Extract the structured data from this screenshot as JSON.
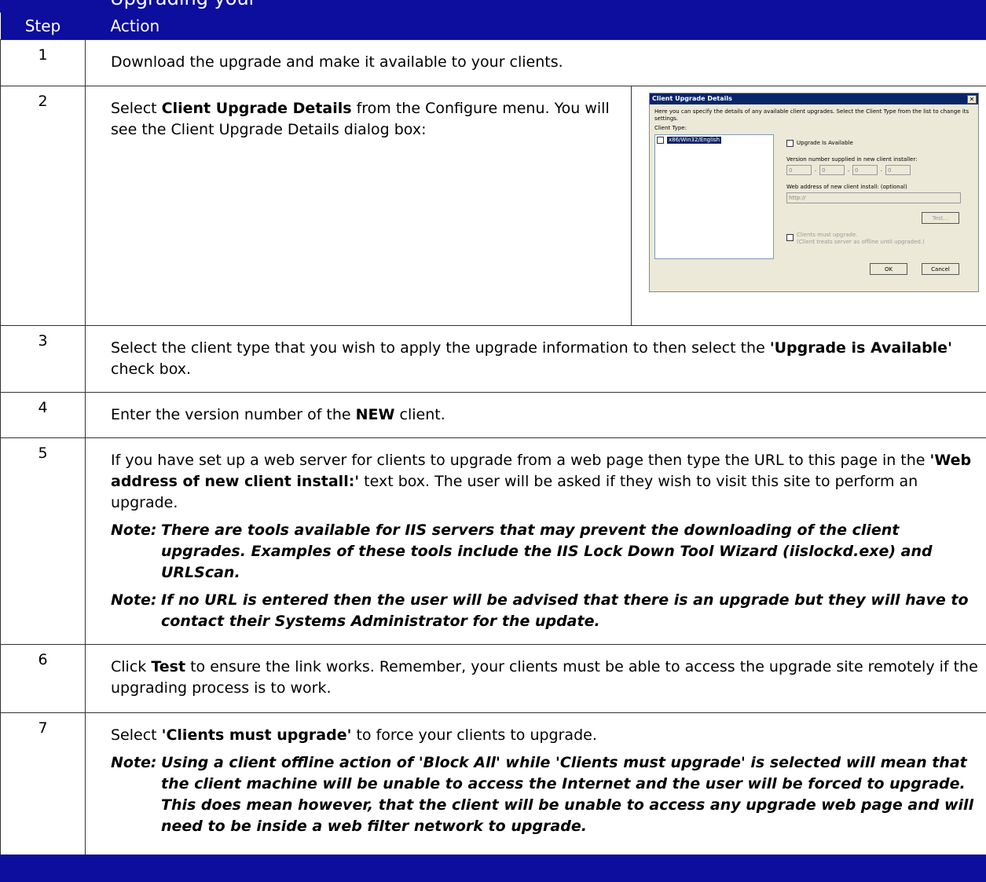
{
  "header": {
    "title_fragment": "Upgrading your",
    "step_label": "Step",
    "action_label": "Action"
  },
  "steps": [
    {
      "num": "1",
      "text": "Download the upgrade and make it available to your clients."
    },
    {
      "num": "2",
      "pre": "Select ",
      "bold": "Client Upgrade Details",
      "post": " from the Configure menu. You will see the Client Upgrade Details dialog box:"
    },
    {
      "num": "3",
      "pre": "Select the client type that you wish to apply the upgrade information to then select the ",
      "bold": "'Upgrade is Available'",
      "post": " check box."
    },
    {
      "num": "4",
      "pre": "Enter the version number of the ",
      "bold": "NEW",
      "post": " client."
    },
    {
      "num": "5",
      "pre": "If you have set up a web server for clients to upgrade from a web page then type the URL to this page in the ",
      "bold": "'Web address of new client install:'",
      "post": " text box. The user will be asked if they wish to visit this site to perform an upgrade.",
      "notes": [
        {
          "label": "Note:",
          "text": "There are tools available for IIS servers that may prevent the downloading of the client upgrades. Examples of these tools include the IIS Lock Down Tool Wizard (iislockd.exe) and URLScan."
        },
        {
          "label": "Note:",
          "text": "If no URL is entered then the user will be advised that there is an upgrade but they will have to contact their Systems Administrator for the update."
        }
      ]
    },
    {
      "num": "6",
      "pre": "Click ",
      "bold": "Test",
      "post": " to ensure the link works. Remember, your clients must be able to access the upgrade site remotely if the upgrading process is to work."
    },
    {
      "num": "7",
      "pre": "Select ",
      "bold": "'Clients must upgrade'",
      "post": " to force your clients to upgrade.",
      "notes": [
        {
          "label": "Note:",
          "text": "Using a client offline action of 'Block All' while 'Clients must upgrade' is selected will mean that the client machine will be unable to access the Internet and the user will be forced to upgrade. This does mean however, that the client will be unable to access any upgrade web page and will need to be inside a web filter network to upgrade."
        }
      ]
    }
  ],
  "dialog": {
    "title": "Client Upgrade Details",
    "close_glyph": "✕",
    "intro": "Here you can specify the details of any available client upgrades.  Select the Client Type from the list to change its settings.",
    "client_type_label": "Client Type:",
    "client_item": "x86/Win32/English",
    "upgrade_available_label": "Upgrade Is Available",
    "version_label": "Version number supplied in new client installer:",
    "version_values": [
      "0",
      "0",
      "0",
      "0"
    ],
    "version_sep": ".",
    "web_label": "Web address of new client install: (optional)",
    "web_value": "http://",
    "test_label": "Test...",
    "must_upgrade_label": "Clients must upgrade.",
    "must_upgrade_sub": "(Client treats server as offline until upgraded.)",
    "ok_label": "OK",
    "cancel_label": "Cancel"
  },
  "colors": {
    "band": "#0d0d9e",
    "dialog_bg": "#ece9d8",
    "dialog_title": "#0a246a"
  }
}
